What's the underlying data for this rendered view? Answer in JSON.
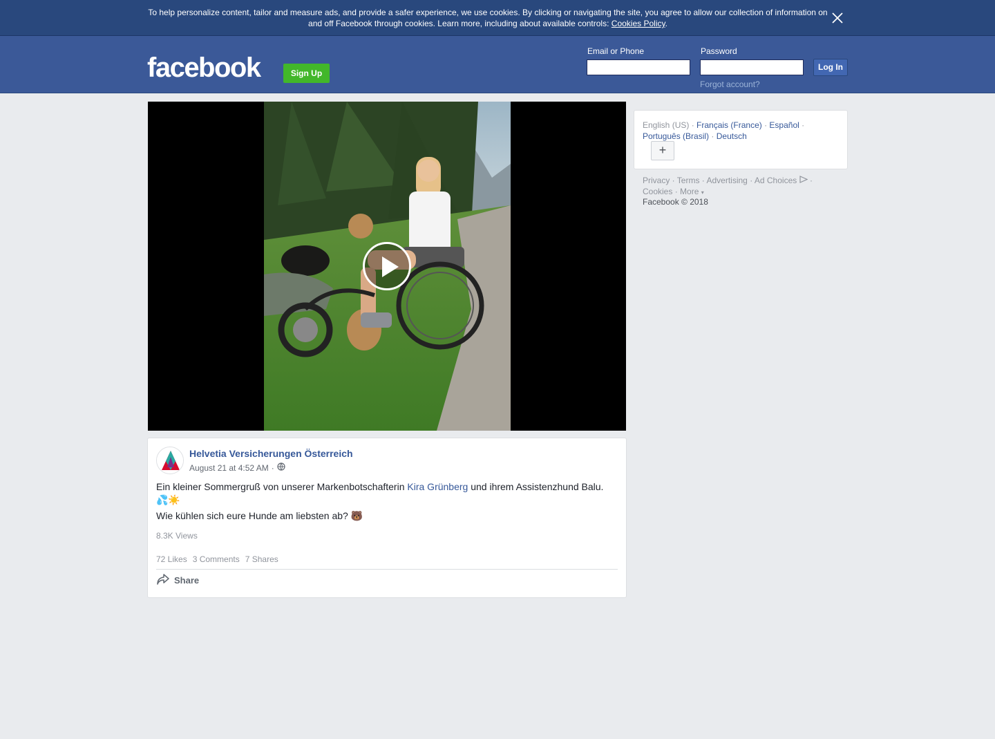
{
  "cookie_banner": {
    "text": "To help personalize content, tailor and measure ads, and provide a safer experience, we use cookies. By clicking or navigating the site, you agree to allow our collection of information on and off Facebook through cookies. Learn more, including about available controls: ",
    "link_label": "Cookies Policy",
    "suffix": ".",
    "close_icon": "close-icon"
  },
  "header": {
    "logo": "facebook",
    "signup_label": "Sign Up",
    "email_label": "Email or Phone",
    "email_value": "",
    "password_label": "Password",
    "password_value": "",
    "login_label": "Log In",
    "forgot_label": "Forgot account?"
  },
  "video": {
    "play_icon": "play-icon"
  },
  "post": {
    "page_name": "Helvetia Versicherungen Österreich",
    "timestamp": "August 21 at 4:52 AM",
    "separator": "·",
    "audience_icon": "globe-icon",
    "text_before": "Ein kleiner Sommergruß von unserer Markenbotschafterin ",
    "mention": "Kira Grünberg",
    "text_after": " und ihrem Assistenzhund Balu.",
    "emojis": "💦☀️",
    "question": "Wie kühlen sich eure Hunde am liebsten ab? 🐻",
    "views": "8.3K Views",
    "likes": "72 Likes",
    "comments": "3 Comments",
    "shares": "7 Shares",
    "share_label": "Share"
  },
  "languages": {
    "current": "English (US)",
    "links": [
      "Français (France)",
      "Español",
      "Português (Brasil)",
      "Deutsch"
    ],
    "more_label": "+"
  },
  "footer": {
    "links": [
      "Privacy",
      "Terms",
      "Advertising",
      "Ad Choices",
      "Cookies",
      "More"
    ],
    "copyright": "Facebook © 2018"
  },
  "colors": {
    "brand_blue": "#3b5998",
    "banner_blue": "#29487d",
    "signup_green": "#42b72a",
    "link_blue": "#365899",
    "background": "#e9ebee"
  }
}
